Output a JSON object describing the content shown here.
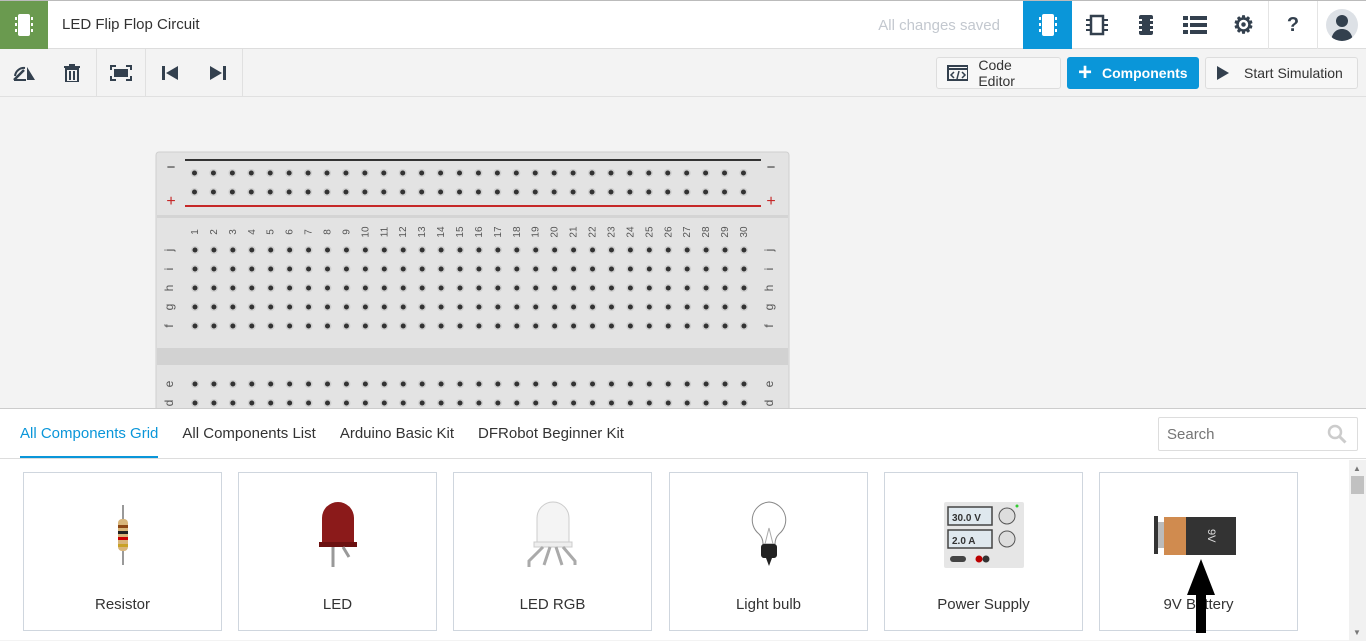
{
  "header": {
    "title": "LED Flip Flop Circuit",
    "status": "All changes saved",
    "icons": [
      "circuit-view-icon",
      "schematic-view-icon",
      "component-list-icon",
      "list-icon",
      "gear-icon",
      "help-icon",
      "avatar"
    ],
    "help": "?",
    "accent": "#0a96d9",
    "brand": "#6a9a4f"
  },
  "toolbar": {
    "icons": [
      "rotate-icon",
      "trash-icon",
      "fit-view-icon",
      "undo-icon",
      "redo-icon"
    ],
    "code_editor": "Code Editor",
    "components": "Components",
    "start_simulation": "Start Simulation"
  },
  "breadboard": {
    "columns": 30,
    "rows_top": [
      "j",
      "i",
      "h",
      "g",
      "f"
    ],
    "rows_bottom": [
      "e",
      "d"
    ],
    "minus": "−",
    "plus": "+"
  },
  "panel": {
    "tabs": [
      {
        "label": "All Components Grid",
        "active": true
      },
      {
        "label": "All Components List"
      },
      {
        "label": "Arduino Basic Kit"
      },
      {
        "label": "DFRobot Beginner Kit"
      }
    ],
    "search_placeholder": "Search",
    "components": [
      {
        "label": "Resistor"
      },
      {
        "label": "LED"
      },
      {
        "label": "LED RGB"
      },
      {
        "label": "Light bulb"
      },
      {
        "label": "Power Supply",
        "readouts": [
          "30.0 V",
          "2.0 A"
        ]
      },
      {
        "label": "9V Battery",
        "battery_text": "9V"
      }
    ]
  }
}
